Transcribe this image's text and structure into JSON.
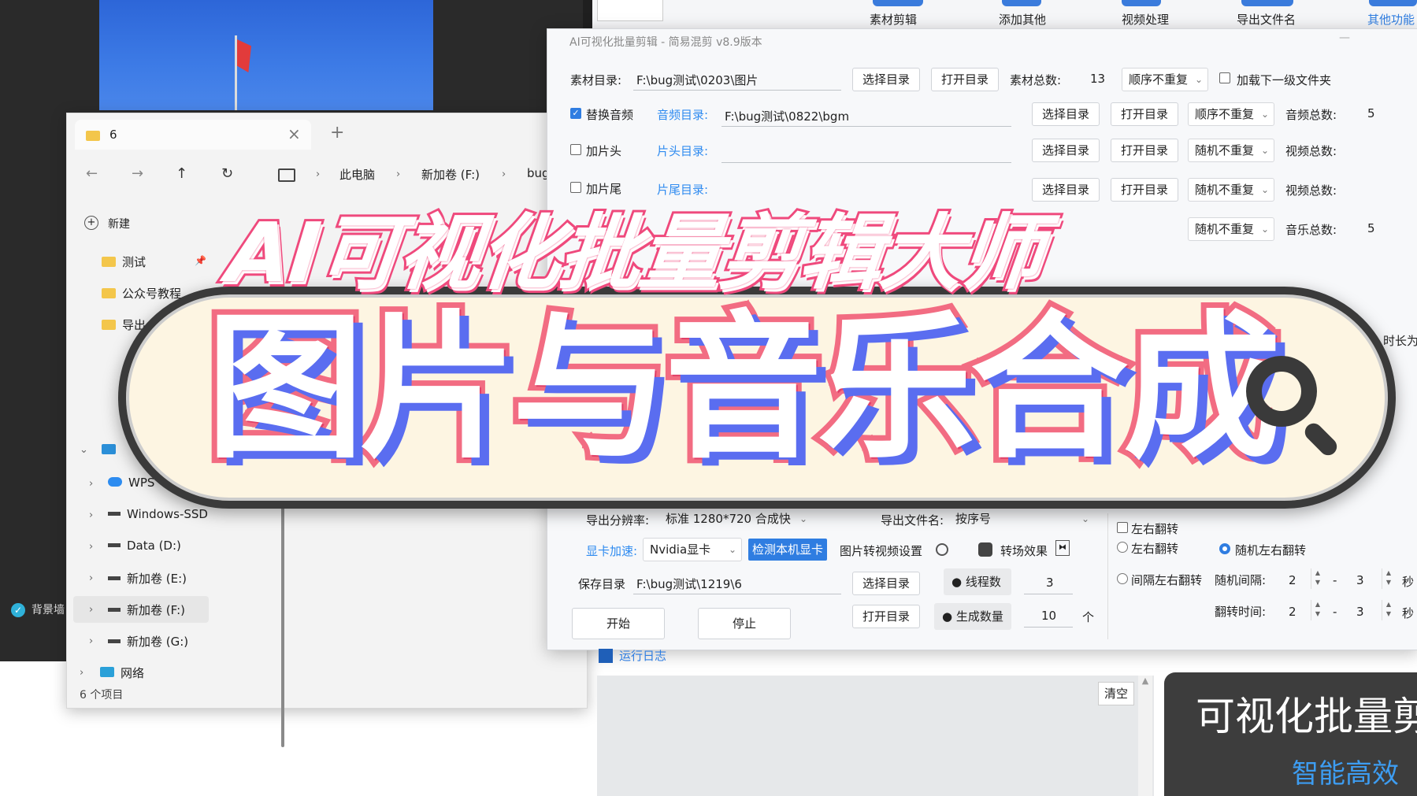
{
  "desktop": {
    "background_checkbox_label": "背景墙"
  },
  "explorer": {
    "tab_title": "6",
    "tab_close": "×",
    "tab_new": "+",
    "nav": {
      "back": "←",
      "forward": "→",
      "up": "↑",
      "refresh": "↻"
    },
    "breadcrumb": [
      "此电脑",
      "新加卷 (F:)",
      "bug"
    ],
    "new_button": "新建",
    "quick_access": [
      "测试",
      "公众号教程",
      "导出"
    ],
    "tree": [
      "WPS",
      "Windows-SSD",
      "Data (D:)",
      "新加卷 (E:)",
      "新加卷 (F:)",
      "新加卷 (G:)",
      "网络"
    ],
    "status": "6 个项目"
  },
  "toolbar": {
    "items": [
      "素材剪辑",
      "添加其他",
      "视频处理",
      "导出文件名",
      "其他功能"
    ]
  },
  "app": {
    "title": "AI可视化批量剪辑 - 简易混剪 v8.9版本",
    "material_dir_label": "素材目录:",
    "material_dir_value": "F:\\bug测试\\0203\\图片",
    "select_dir": "选择目录",
    "open_dir": "打开目录",
    "material_total_label": "素材总数:",
    "material_total_value": "13",
    "order_no_repeat": "顺序不重复",
    "random_no_repeat": "随机不重复",
    "load_subfolder": "加载下一级文件夹",
    "replace_audio": "替换音频",
    "audio_dir_label": "音频目录:",
    "audio_dir_value": "F:\\bug测试\\0822\\bgm",
    "audio_total_label": "音频总数:",
    "audio_total_value": "5",
    "add_head": "加片头",
    "head_dir_label": "片头目录:",
    "video_total_label": "视频总数:",
    "add_tail": "加片尾",
    "tail_dir_label": "片尾目录:",
    "music_total_label": "音乐总数:",
    "music_total_value": "5",
    "right_edge_text": "时长为",
    "export_res_label": "导出分辨率:",
    "export_res_value": "标准 1280*720 合成快",
    "export_name_label": "导出文件名:",
    "export_name_value": "按序号",
    "gpu_label": "显卡加速:",
    "gpu_value": "Nvidia显卡",
    "gpu_detect": "检测本机显卡",
    "img2video": "图片转视频设置",
    "transition": "转场效果",
    "save_dir_label": "保存目录",
    "save_dir_value": "F:\\bug测试\\1219\\6",
    "threads_label": "线程数",
    "threads_value": "3",
    "gen_count_label": "生成数量",
    "gen_count_value": "10",
    "gen_unit": "个",
    "start": "开始",
    "stop": "停止",
    "flip_lr_1": "左右翻转",
    "flip_lr_2": "左右翻转",
    "random_flip": "随机左右翻转",
    "interval_flip": "间隔左右翻转",
    "random_interval_label": "随机间隔:",
    "random_interval_min": "2",
    "random_interval_max": "3",
    "flip_time_label": "翻转时间:",
    "flip_time_min": "2",
    "flip_time_max": "3",
    "dash": "-",
    "sec": "秒",
    "log_title": "运行日志",
    "clear": "清空"
  },
  "promo": {
    "title": "可视化批量剪",
    "subtitle": "智能高效"
  },
  "banner": {
    "top_title": "AI可视化批量剪辑大师",
    "main_title": "图片与音乐合成"
  }
}
